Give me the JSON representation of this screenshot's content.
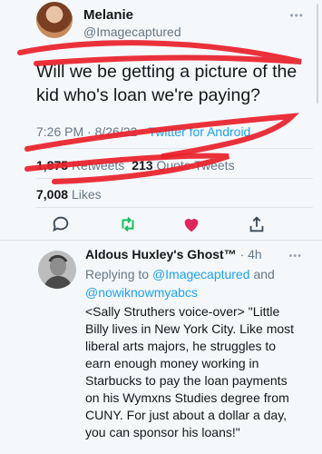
{
  "tweet": {
    "author_name": "Melanie",
    "author_handle": "@Imagecaptured",
    "more_icon": "more-dots-icon",
    "text": "Will we be getting a picture of the kid who's loan we're paying?",
    "time": "7:26 PM",
    "separator1": "·",
    "date": "8/26/22",
    "separator2": "·",
    "source": "Twitter for Android",
    "retweets_count": "1,875",
    "retweets_label": "Retweets",
    "quote_count": "213",
    "quote_label": "Quote Tweets",
    "likes_count": "7,008",
    "likes_label": "Likes"
  },
  "actions": [
    {
      "name": "reply-icon"
    },
    {
      "name": "retweet-icon",
      "color": "#17bf63"
    },
    {
      "name": "heart-icon",
      "color": "#e0245e"
    },
    {
      "name": "share-icon"
    }
  ],
  "reply": {
    "author_name": "Aldous Huxley's Ghost™",
    "time": "· 4h",
    "replying_prefix": "Replying to",
    "mention1": "@Imagecaptured",
    "and": "and",
    "mention2": "@nowiknowmyabcs",
    "text": "<Sally Struthers voice-over> \"Little Billy lives in New York City. Like most liberal arts majors, he struggles to earn enough money working in Starbucks to pay the loan payments on his Wymxns Studies degree from CUNY. For just about a dollar a day, you can sponsor his loans!\""
  },
  "colors": {
    "link": "#1da1f2",
    "scribble": "#e8202a"
  }
}
